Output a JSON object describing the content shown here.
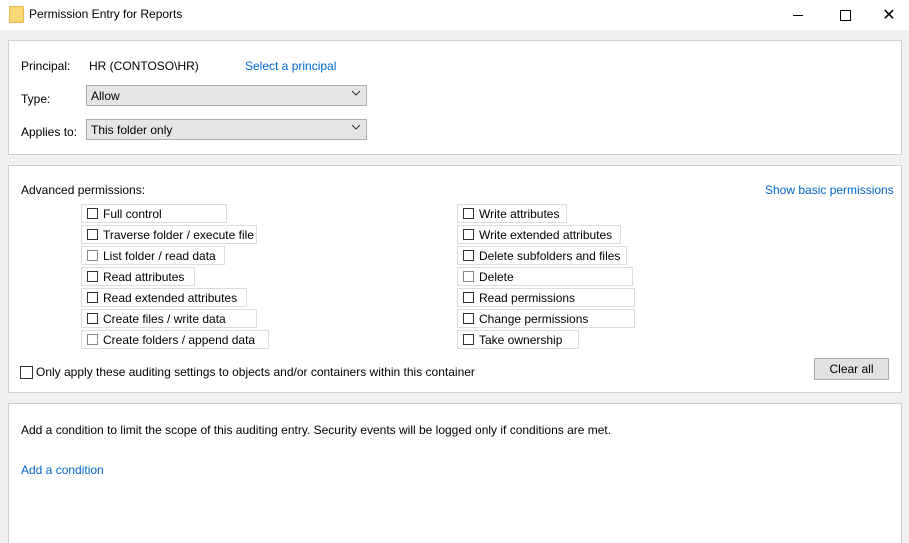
{
  "window": {
    "title": "Permission Entry for Reports",
    "icon": "folder-icon",
    "controls": {
      "minimize": "minimize-icon",
      "maximize": "maximize-icon",
      "close": "✕"
    }
  },
  "principal_section": {
    "principal_label": "Principal:",
    "principal_value": "HR (CONTOSO\\HR)",
    "select_principal_link": "Select a principal",
    "type_label": "Type:",
    "type_value": "Allow",
    "applies_to_label": "Applies to:",
    "applies_to_value": "This folder only"
  },
  "permissions_section": {
    "heading": "Advanced permissions:",
    "show_basic_link": "Show basic permissions",
    "left_column": [
      {
        "label": "Full control",
        "checked": false
      },
      {
        "label": "Traverse folder / execute file",
        "checked": false
      },
      {
        "label": "List folder / read data",
        "checked": false
      },
      {
        "label": "Read attributes",
        "checked": false
      },
      {
        "label": "Read extended attributes",
        "checked": false
      },
      {
        "label": "Create files / write data",
        "checked": false
      },
      {
        "label": "Create folders / append data",
        "checked": false
      }
    ],
    "right_column": [
      {
        "label": "Write attributes",
        "checked": false
      },
      {
        "label": "Write extended attributes",
        "checked": false
      },
      {
        "label": "Delete subfolders and files",
        "checked": false
      },
      {
        "label": "Delete",
        "checked": false
      },
      {
        "label": "Read permissions",
        "checked": false
      },
      {
        "label": "Change permissions",
        "checked": false
      },
      {
        "label": "Take ownership",
        "checked": false
      }
    ],
    "only_apply_label": "Only apply these auditing settings to objects and/or containers within this container",
    "only_apply_checked": false,
    "clear_all_label": "Clear all"
  },
  "condition_section": {
    "description": "Add a condition to limit the scope of this auditing entry. Security events will be logged only if conditions are met.",
    "add_condition_link": "Add a condition"
  },
  "colors": {
    "link": "#0066cc",
    "background": "#f0f0f0",
    "panel": "#ffffff"
  }
}
